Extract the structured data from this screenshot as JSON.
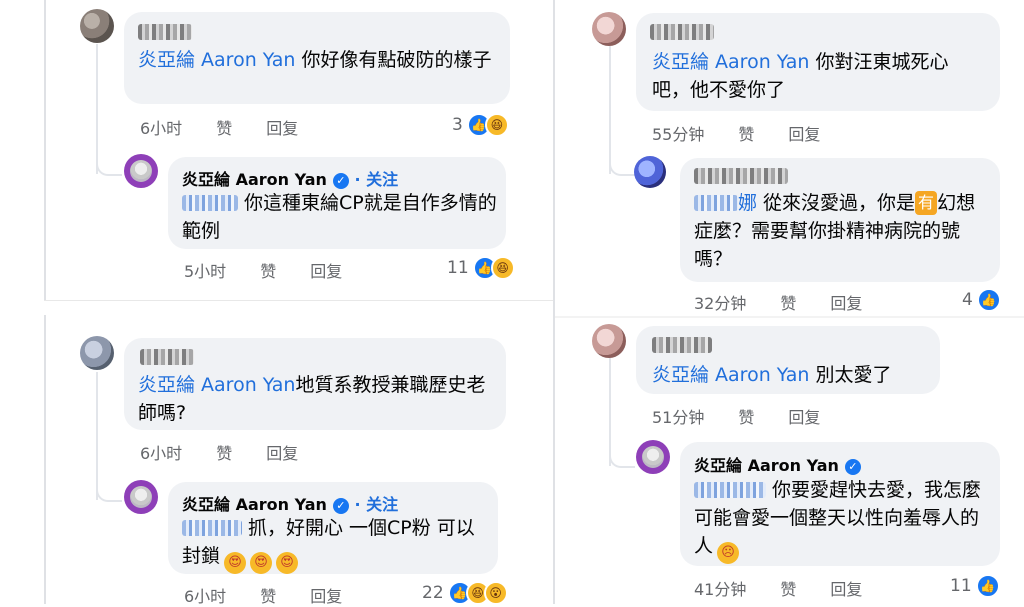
{
  "reactions_icon": "like-icon",
  "left_top": {
    "comment": {
      "mention": "炎亞綸 Aaron Yan",
      "text": " 你好像有點破防的樣子",
      "time": "6小时",
      "like": "赞",
      "reply": "回复",
      "count": "3"
    },
    "reply": {
      "author": "炎亞綸 Aaron Yan",
      "follow": "· 关注",
      "text": "你這種東綸CP就是自作多情的範例",
      "time": "5小时",
      "like": "赞",
      "reply": "回复",
      "count": "11"
    }
  },
  "left_bottom": {
    "comment": {
      "mention": "炎亞綸 Aaron Yan",
      "text": "地質系教授兼職歷史老師嗎?",
      "time": "6小时",
      "like": "赞",
      "reply": "回复"
    },
    "reply": {
      "author": "炎亞綸 Aaron Yan",
      "follow": "· 关注",
      "text": "抓，好開心 一個CP粉 可以封鎖",
      "time": "6小时",
      "like": "赞",
      "reply": "回复",
      "count": "22"
    }
  },
  "right_top": {
    "comment": {
      "mention": "炎亞綸 Aaron Yan",
      "text": " 你對汪東城死心吧，他不愛你了",
      "time": "55分钟",
      "like": "赞",
      "reply": "回复"
    },
    "reply": {
      "mention_partial": "娜",
      "text_a": " 從來沒愛過，你是",
      "emoji_box": "有",
      "text_b": "幻想症麼？需要幫你掛精神病院的號嗎？",
      "time": "32分钟",
      "like": "赞",
      "reply": "回复",
      "count": "4"
    }
  },
  "right_bottom": {
    "comment": {
      "mention": "炎亞綸 Aaron Yan",
      "text": " 別太愛了",
      "time": "51分钟",
      "like": "赞",
      "reply": "回复"
    },
    "reply": {
      "author": "炎亞綸 Aaron Yan",
      "text": "你要愛趕快去愛，我怎麼可能會愛一個整天以性向羞辱人的人",
      "time": "41分钟",
      "like": "赞",
      "reply": "回复",
      "count": "11"
    }
  }
}
